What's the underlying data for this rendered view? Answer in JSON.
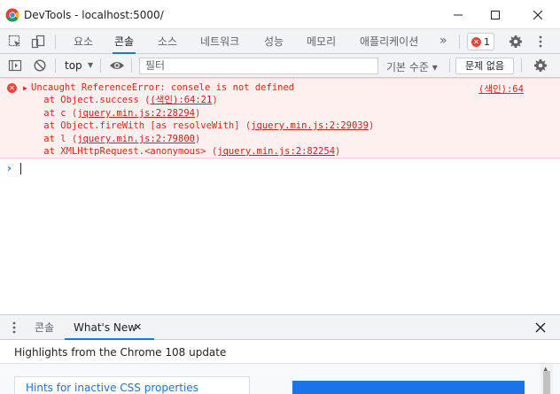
{
  "window": {
    "title": "DevTools - localhost:5000/"
  },
  "tabs": [
    {
      "label": "요소"
    },
    {
      "label": "콘솔"
    },
    {
      "label": "소스"
    },
    {
      "label": "네트워크"
    },
    {
      "label": "성능"
    },
    {
      "label": "메모리"
    },
    {
      "label": "애플리케이션"
    }
  ],
  "more_tabs": "»",
  "error_count": "1",
  "console_toolbar": {
    "context": "top",
    "filter_placeholder": "필터",
    "levels": "기본 수준 ▾",
    "issues": "문제 없음"
  },
  "error": {
    "message": "Uncaught ReferenceError: consele is not defined",
    "source_link": "(색인):64",
    "stack": [
      {
        "prefix": "    at Object.success (",
        "link": "(색인):64:21",
        "suffix": ")"
      },
      {
        "prefix": "    at c (",
        "link": "jquery.min.js:2:28294",
        "suffix": ")"
      },
      {
        "prefix": "    at Object.fireWith [as resolveWith] (",
        "link": "jquery.min.js:2:29039",
        "suffix": ")"
      },
      {
        "prefix": "    at l (",
        "link": "jquery.min.js:2:79800",
        "suffix": ")"
      },
      {
        "prefix": "    at XMLHttpRequest.<anonymous> (",
        "link": "jquery.min.js:2:82254",
        "suffix": ")"
      }
    ]
  },
  "drawer": {
    "tabs": [
      {
        "label": "콘솔"
      },
      {
        "label": "What's New"
      }
    ],
    "whats_new_title": "Highlights from the Chrome 108 update",
    "card_title": "Hints for inactive CSS properties"
  },
  "colors": {
    "accent": "#1a73e8",
    "error_text": "#e0251b",
    "error_bg": "#fff0f0"
  }
}
